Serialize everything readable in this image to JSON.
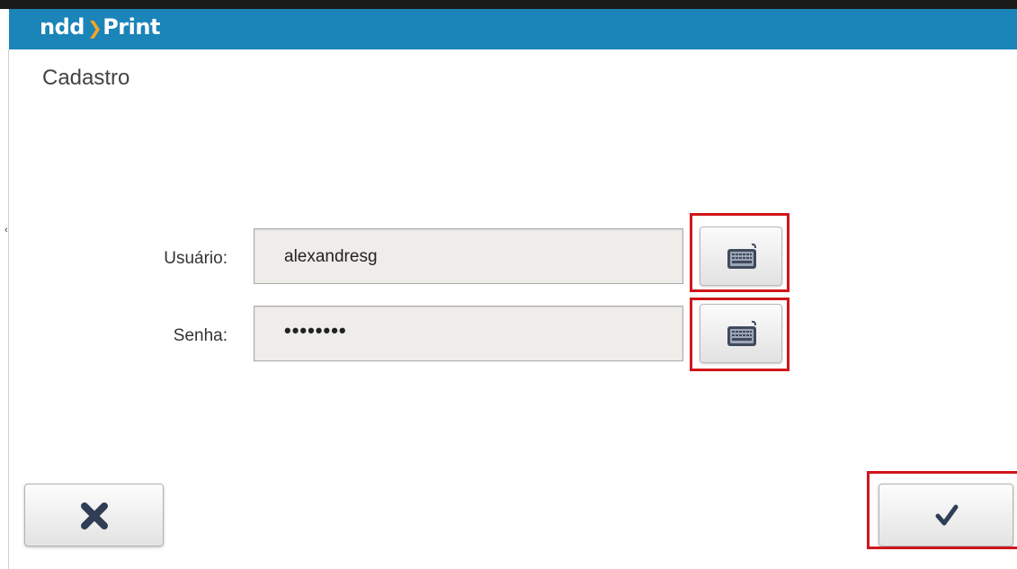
{
  "header": {
    "brand_left": "ndd",
    "brand_right": "Print",
    "color": "#1b84b8"
  },
  "page": {
    "title": "Cadastro"
  },
  "form": {
    "user": {
      "label": "Usuário:",
      "value": "alexandresg"
    },
    "password": {
      "label": "Senha:",
      "masked_value": "••••••••"
    }
  },
  "buttons": {
    "user_keyboard_icon": "keyboard-icon",
    "password_keyboard_icon": "keyboard-icon",
    "cancel_icon": "close-icon",
    "confirm_icon": "check-icon"
  },
  "highlight_color": "#d0161b"
}
